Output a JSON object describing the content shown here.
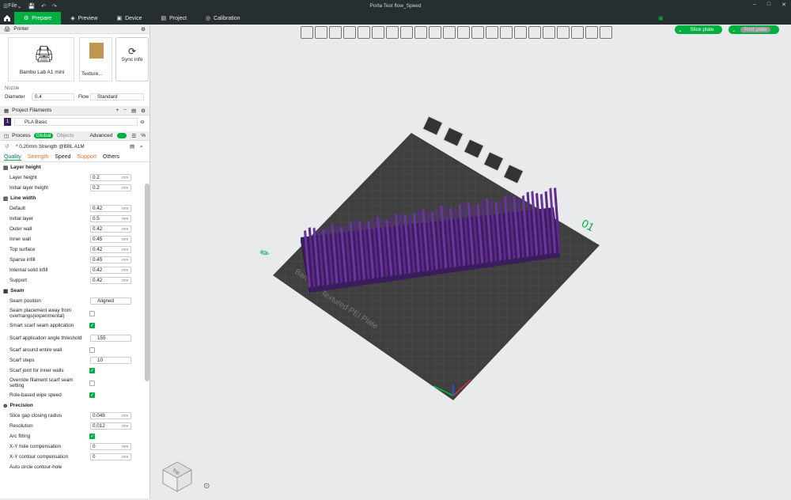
{
  "window": {
    "menu": "File",
    "title": "Porta Test flow_Speed"
  },
  "tabs": [
    {
      "label": "Prepare"
    },
    {
      "label": "Preview"
    },
    {
      "label": "Device"
    },
    {
      "label": "Project"
    },
    {
      "label": "Calibration"
    }
  ],
  "actions": {
    "slice": "Slice plate",
    "print": "Print plate"
  },
  "printer": {
    "section": "Printer",
    "name": "Bambu Lab A1 mini",
    "plate": "Texture...",
    "sync": "Sync info",
    "nozzle_label": "Nozzle",
    "diameter_label": "Diameter",
    "diameter": "0.4",
    "flow_label": "Flow",
    "flow": "Standard"
  },
  "filaments": {
    "section": "Project Filaments",
    "index": "1",
    "name": "PLA Basic"
  },
  "process": {
    "section": "Process",
    "global": "Global",
    "objects": "Objects",
    "advanced": "Advanced",
    "preset": "* 0.20mm Strength @BBL A1M",
    "tabs": [
      "Quality",
      "Strength",
      "Speed",
      "Support",
      "Others"
    ]
  },
  "groups": {
    "layer": {
      "title": "Layer height",
      "rows": [
        {
          "label": "Layer height",
          "value": "0.2",
          "unit": "mm"
        },
        {
          "label": "Initial layer height",
          "value": "0.2",
          "unit": "mm"
        }
      ]
    },
    "line": {
      "title": "Line width",
      "rows": [
        {
          "label": "Default",
          "value": "0.42",
          "unit": "mm"
        },
        {
          "label": "Initial layer",
          "value": "0.5",
          "unit": "mm"
        },
        {
          "label": "Outer wall",
          "value": "0.42",
          "unit": "mm"
        },
        {
          "label": "Inner wall",
          "value": "0.45",
          "unit": "mm"
        },
        {
          "label": "Top surface",
          "value": "0.42",
          "unit": "mm"
        },
        {
          "label": "Sparse infill",
          "value": "0.45",
          "unit": "mm"
        },
        {
          "label": "Internal solid infill",
          "value": "0.42",
          "unit": "mm"
        },
        {
          "label": "Support",
          "value": "0.42",
          "unit": "mm"
        }
      ]
    },
    "seam": {
      "title": "Seam",
      "position_label": "Seam position",
      "position": "Aligned",
      "away": "Seam placement away from overhangs(experimental)",
      "smart": "Smart scarf seam application",
      "angle": "Scarf application angle threshold",
      "angle_val": "155",
      "entire": "Scarf around entire wall",
      "steps": "Scarf steps",
      "steps_val": "10",
      "inner": "Scarf joint for inner walls",
      "override": "Override filament scarf seam setting",
      "role": "Role-based wipe speed"
    },
    "precision": {
      "title": "Precision",
      "rows": [
        {
          "label": "Slice gap closing radius",
          "value": "0.049",
          "unit": "mm"
        },
        {
          "label": "Resolution",
          "value": "0.012",
          "unit": "mm"
        }
      ],
      "arc": "Arc fitting",
      "xyhole": "X-Y hole compensation",
      "xyhole_val": "0",
      "xycont": "X-Y contour compensation",
      "xycont_val": "0",
      "auto": "Auto circle contour-hole"
    }
  },
  "plate": {
    "label": "Textured PEI Plate",
    "brand": "Bambu",
    "number": "01"
  },
  "cube": {
    "label": "Top"
  },
  "colors": {
    "accent": "#00ae42",
    "model": "#5a2a86"
  }
}
